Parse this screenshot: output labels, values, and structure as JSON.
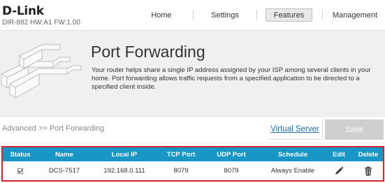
{
  "header": {
    "brand": "D-Link",
    "model_info": "DIR-882 HW:A1 FW:1.00",
    "nav": [
      "Home",
      "Settings",
      "Features",
      "Management"
    ],
    "active_nav": "Features"
  },
  "banner": {
    "title": "Port Forwarding",
    "description": "Your router helps share a single IP address assigned by your ISP among several clients in your home. Port forwarding allows traffic requests from a specified application to be directed to a specified client inside."
  },
  "toolbar": {
    "breadcrumb": "Advanced >> Port Forwarding",
    "virtual_server_label": "Virtual Server",
    "save_label": "Save"
  },
  "table": {
    "headers": [
      "Status",
      "Name",
      "Local IP",
      "TCP Port",
      "UDP Port",
      "Schedule",
      "Edit",
      "Delete"
    ],
    "rows": [
      {
        "status": "checked",
        "name": "DCS-7517",
        "local_ip": "192.168.0.111",
        "tcp_port": "8079",
        "udp_port": "8079",
        "schedule": "Always Enable",
        "edit_icon": "pencil-icon",
        "delete_icon": "trash-icon"
      }
    ]
  },
  "colors": {
    "table_header": "#1897c7",
    "highlight_border": "#d4232b",
    "link": "#1e6fb3",
    "save_disabled": "#cfcfcf"
  }
}
